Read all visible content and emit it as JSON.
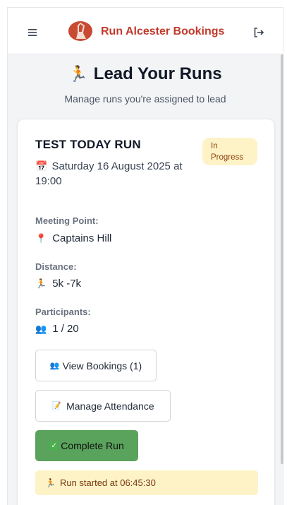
{
  "header": {
    "brand": "Run Alcester Bookings",
    "menu_icon": "hamburger-menu-icon",
    "logout_icon": "logout-icon"
  },
  "page": {
    "title_emoji": "🏃",
    "title": "Lead Your Runs",
    "subtitle": "Manage runs you're assigned to lead"
  },
  "run": {
    "title": "TEST TODAY RUN",
    "status": "In Progress",
    "date_emoji": "📅",
    "date": "Saturday 16 August 2025 at 19:00",
    "meeting_point_label": "Meeting Point:",
    "meeting_point_emoji": "📍",
    "meeting_point": "Captains Hill",
    "distance_label": "Distance:",
    "distance_emoji": "🏃",
    "distance": "5k -7k",
    "participants_label": "Participants:",
    "participants_emoji": "👥",
    "participants": "1 / 20",
    "view_bookings_emoji": "👥",
    "view_bookings_label": "View Bookings (1)",
    "manage_attendance_emoji": "📝",
    "manage_attendance_label": "Manage Attendance",
    "complete_emoji": "✓",
    "complete_label": "Complete Run",
    "started_emoji": "🏃",
    "started_text": "Run started at 06:45:30"
  },
  "colors": {
    "brand": "#c0392b",
    "complete_button": "#5aa35c",
    "status_badge_bg": "#fdf3c7",
    "status_badge_text": "#92400e"
  }
}
